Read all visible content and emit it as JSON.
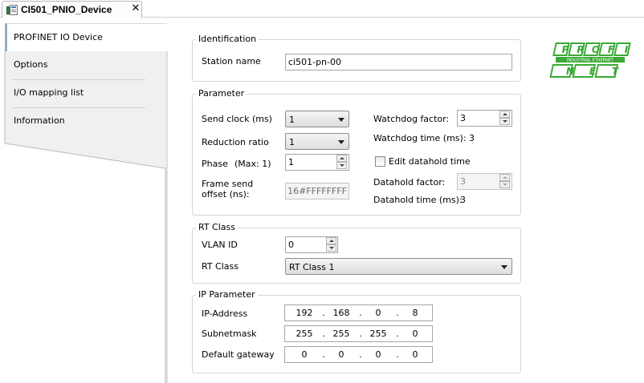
{
  "document_tab": {
    "title": "CI501_PNIO_Device",
    "close_glyph": "✕"
  },
  "sidebar": {
    "items": [
      {
        "label": "PROFINET IO Device"
      },
      {
        "label": "Options"
      },
      {
        "label": "I/O mapping list"
      },
      {
        "label": "Information"
      }
    ]
  },
  "identification": {
    "group_title": "Identification",
    "station_name_label": "Station name",
    "station_name_value": "ci501-pn-00"
  },
  "parameter": {
    "group_title": "Parameter",
    "send_clock_label": "Send clock (ms)",
    "send_clock_value": "1",
    "reduction_ratio_label": "Reduction ratio",
    "reduction_ratio_value": "1",
    "phase_label": "Phase",
    "phase_max_label": "(Max: 1)",
    "phase_value": "1",
    "frame_send_offset_label_1": "Frame send",
    "frame_send_offset_label_2": "offset (ns):",
    "frame_send_offset_value": "16#FFFFFFFF",
    "watchdog_factor_label": "Watchdog factor:",
    "watchdog_factor_value": "3",
    "watchdog_time_text": "Watchdog time (ms): 3",
    "edit_datahold_label": "Edit datahold time",
    "datahold_factor_label": "Datahold factor:",
    "datahold_factor_value": "3",
    "datahold_time_label": "Datahold time (ms):",
    "datahold_time_value": "3"
  },
  "rt_class": {
    "group_title": "RT Class",
    "vlan_id_label": "VLAN ID",
    "vlan_id_value": "0",
    "rt_class_label": "RT Class",
    "rt_class_value": "RT Class 1"
  },
  "ip_parameter": {
    "group_title": "IP Parameter",
    "ip_address_label": "IP-Address",
    "ip_address": [
      "192",
      "168",
      "0",
      "8"
    ],
    "subnetmask_label": "Subnetmask",
    "subnetmask": [
      "255",
      "255",
      "255",
      "0"
    ],
    "default_gateway_label": "Default gateway",
    "default_gateway": [
      "0",
      "0",
      "0",
      "0"
    ]
  },
  "logo": {
    "top_letters": [
      "P",
      "R",
      "O",
      "F",
      "I"
    ],
    "subtitle": "INDUSTRIAL ETHERNET",
    "bottom_letters": [
      "N",
      "E",
      "T"
    ],
    "color": "#3aa935"
  }
}
